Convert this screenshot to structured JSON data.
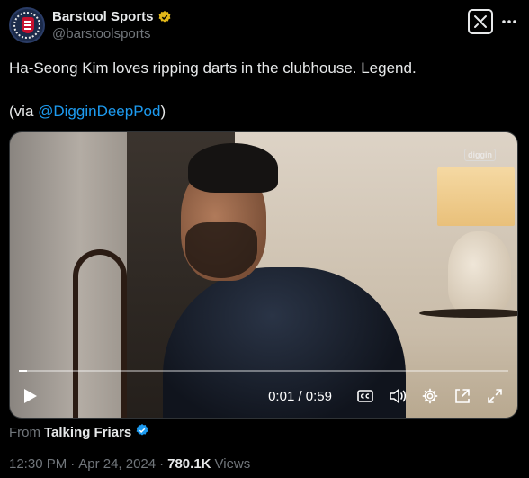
{
  "author": {
    "display_name": "Barstool Sports",
    "handle": "@barstoolsports",
    "verified_color": "#e2b719"
  },
  "tweet": {
    "line1": "Ha-Seong Kim loves ripping darts in the clubhouse. Legend.",
    "via_prefix": "(via ",
    "via_mention": "@DigginDeepPod",
    "via_suffix": ")"
  },
  "video": {
    "time_display": "0:01 / 0:59",
    "progress_fraction": 0.017,
    "watermark": "diggin"
  },
  "attribution": {
    "from_label": "From",
    "source_name": "Talking Friars",
    "verified_color": "#1d9bf0"
  },
  "meta": {
    "time": "12:30 PM",
    "date": "Apr 24, 2024",
    "views_count": "780.1K",
    "views_label": "Views"
  },
  "icons": {
    "grok": "grok-icon",
    "more": "more-icon",
    "play": "play-icon",
    "captions": "captions-icon",
    "volume": "volume-icon",
    "settings": "settings-icon",
    "pip": "pip-icon",
    "fullscreen": "fullscreen-icon"
  },
  "colors": {
    "background": "#000000",
    "text": "#e7e9ea",
    "muted": "#71767b",
    "link": "#1d9bf0"
  }
}
